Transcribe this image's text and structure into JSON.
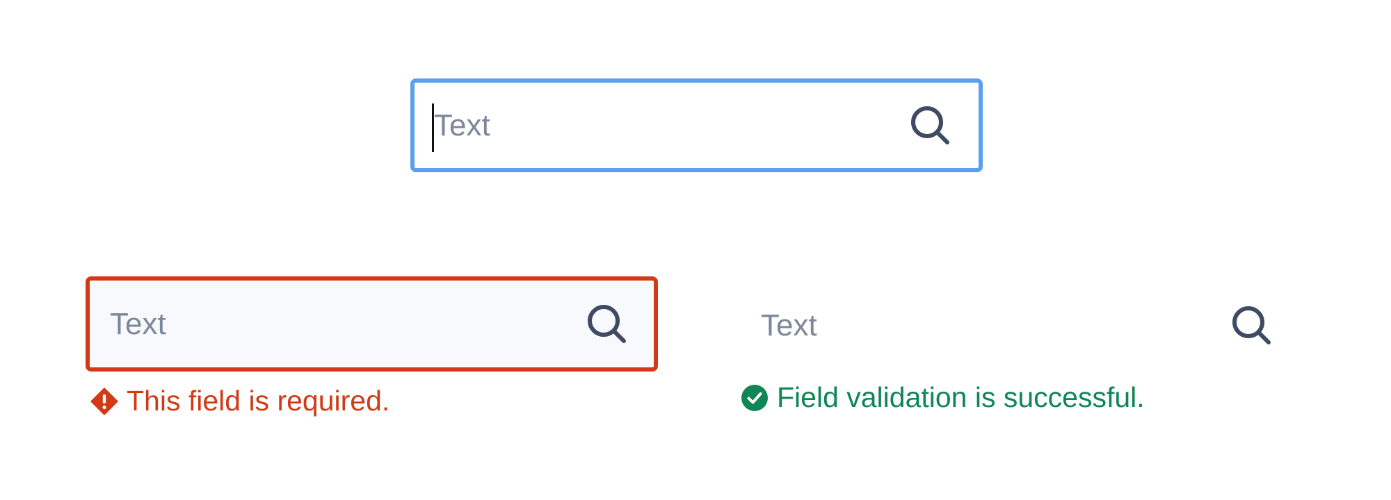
{
  "fields": {
    "focused": {
      "placeholder": "Text",
      "state": "focused",
      "border_color": "#5a9ff0",
      "icon": "search-icon"
    },
    "error": {
      "placeholder": "Text",
      "state": "error",
      "border_color": "#d23a16",
      "icon": "search-icon",
      "message": "This field is required.",
      "message_icon": "alert-diamond-icon",
      "message_color": "#d23a16"
    },
    "success": {
      "placeholder": "Text",
      "state": "success",
      "icon": "search-icon",
      "message": "Field validation is successful.",
      "message_icon": "check-circle-icon",
      "message_color": "#108556"
    }
  },
  "colors": {
    "placeholder_text": "#7d879c",
    "icon": "#3f4a63",
    "focus": "#5a9ff0",
    "error": "#d23a16",
    "success": "#108556"
  }
}
